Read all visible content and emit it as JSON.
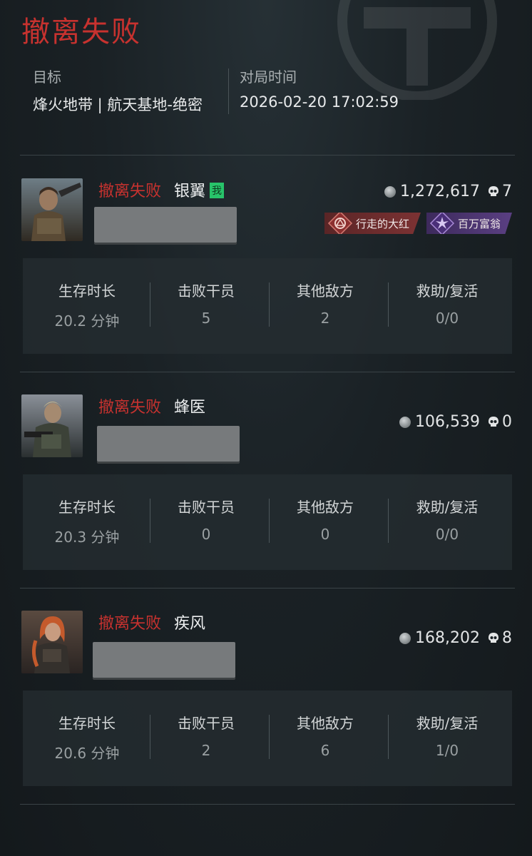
{
  "header": {
    "title": "撤离失败",
    "target_label": "目标",
    "target_value": "烽火地带 | 航天基地-绝密",
    "time_label": "对局时间",
    "time_value": "2026-02-20 17:02:59"
  },
  "players": [
    {
      "status": "撤离失败",
      "name": "银翼",
      "me_tag": "我",
      "value": "1,272,617",
      "kills": "7",
      "badges": [
        "行走的大红",
        "百万富翁"
      ],
      "stats": [
        {
          "label": "生存时长",
          "value": "20.2 分钟"
        },
        {
          "label": "击败干员",
          "value": "5"
        },
        {
          "label": "其他敌方",
          "value": "2"
        },
        {
          "label": "救助/复活",
          "value": "0/0"
        }
      ]
    },
    {
      "status": "撤离失败",
      "name": "蜂医",
      "value": "106,539",
      "kills": "0",
      "stats": [
        {
          "label": "生存时长",
          "value": "20.3 分钟"
        },
        {
          "label": "击败干员",
          "value": "0"
        },
        {
          "label": "其他敌方",
          "value": "0"
        },
        {
          "label": "救助/复活",
          "value": "0/0"
        }
      ]
    },
    {
      "status": "撤离失败",
      "name": "疾风",
      "value": "168,202",
      "kills": "8",
      "stats": [
        {
          "label": "生存时长",
          "value": "20.6 分钟"
        },
        {
          "label": "击败干员",
          "value": "2"
        },
        {
          "label": "其他敌方",
          "value": "6"
        },
        {
          "label": "救助/复活",
          "value": "1/0"
        }
      ]
    }
  ],
  "icons": {
    "value": "coin-icon",
    "kills": "skull-icon",
    "badge_1": "red-triangle-badge-icon",
    "badge_2": "purple-burst-badge-icon"
  },
  "colors": {
    "status_red": "#c7322f",
    "me_tag_green": "#28c46a",
    "background": "#1a2125"
  }
}
